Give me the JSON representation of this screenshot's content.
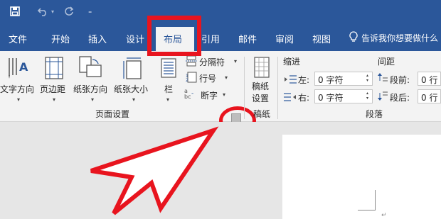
{
  "app": {
    "title_bar_color": "#2b579a",
    "accent": "#e8141e"
  },
  "quick_access": {
    "save_icon": "save-icon",
    "undo_icon": "undo-icon",
    "redo_icon": "redo-icon",
    "customize_icon": "customize-qat-icon"
  },
  "tabs": [
    "文件",
    "开始",
    "插入",
    "设计",
    "布局",
    "引用",
    "邮件",
    "审阅",
    "视图"
  ],
  "active_tab": "布局",
  "tell_me": "告诉我你想要做什么",
  "page_setup": {
    "text_direction": "文字方向",
    "margins": "页边距",
    "orientation": "纸张方向",
    "size": "纸张大小",
    "columns": "栏",
    "breaks": "分隔符",
    "line_numbers": "行号",
    "hyphenation": "断字",
    "group_label": "页面设置"
  },
  "manuscript": {
    "button": "稿纸\n设置",
    "group_label": "稿纸"
  },
  "indent": {
    "header": "缩进",
    "left_label": "左:",
    "left_value": "0 字符",
    "right_label": "右:",
    "right_value": "0 字符"
  },
  "spacing": {
    "header": "间距",
    "before_label": "段前:",
    "before_value": "0 行",
    "after_label": "段后:",
    "after_value": "0 行"
  },
  "paragraph": {
    "group_label": "段落"
  }
}
